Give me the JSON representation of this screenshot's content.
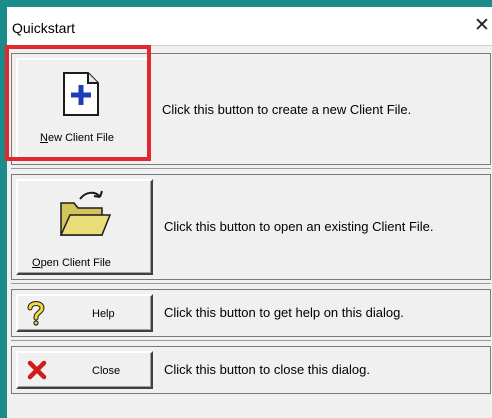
{
  "window": {
    "title": "Quickstart",
    "close_glyph": "✕"
  },
  "buttons": [
    {
      "id": "new-client-file",
      "label_mnemonic": "N",
      "label_rest": "ew Client File",
      "icon": "new-document-icon",
      "description": "Click this button to create a new Client File."
    },
    {
      "id": "open-client-file",
      "label_mnemonic": "O",
      "label_rest": "pen Client File",
      "icon": "open-folder-icon",
      "description": "Click this button to open an existing Client File."
    },
    {
      "id": "help",
      "label": "Help",
      "icon": "question-mark-icon",
      "description": "Click this button to get help on this dialog."
    },
    {
      "id": "close",
      "label": "Close",
      "icon": "red-x-icon",
      "description": "Click this button to close this dialog."
    }
  ],
  "colors": {
    "highlight": "#e0282e",
    "background_frame": "#1a8c8c"
  }
}
